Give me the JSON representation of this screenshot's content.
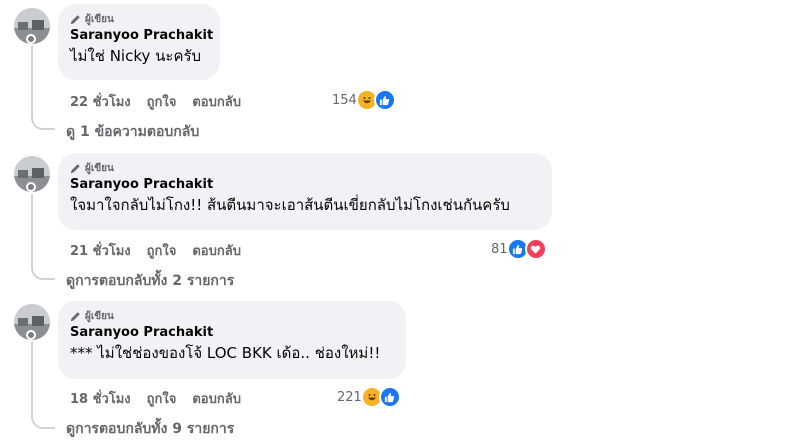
{
  "comments": [
    {
      "badge": "ผู้เขียน",
      "author": "Saranyoo Prachakit",
      "text": "ไม่ใช่ Nicky นะครับ",
      "time": "22 ชั่วโมง",
      "like_label": "ถูกใจ",
      "reply_label": "ตอบกลับ",
      "reaction_count": "154",
      "reactions": [
        "haha",
        "like"
      ],
      "replies_link": "ดู 1 ข้อความตอบกลับ"
    },
    {
      "badge": "ผู้เขียน",
      "author": "Saranyoo Prachakit",
      "text": "ใจมาใจกลับไม่โกง!! ส้นตีนมาจะเอาส้นตีนเขี่ยกลับไม่โกงเช่นกันครับ",
      "time": "21 ชั่วโมง",
      "like_label": "ถูกใจ",
      "reply_label": "ตอบกลับ",
      "reaction_count": "81",
      "reactions": [
        "like",
        "love"
      ],
      "replies_link": "ดูการตอบกลับทั้ง 2 รายการ"
    },
    {
      "badge": "ผู้เขียน",
      "author": "Saranyoo Prachakit",
      "text": "*** ไม่ใช่ช่องของโจ้ LOC BKK เด้อ.. ช่องใหม่!!",
      "time": "18 ชั่วโมง",
      "like_label": "ถูกใจ",
      "reply_label": "ตอบกลับ",
      "reaction_count": "221",
      "reactions": [
        "haha",
        "like"
      ],
      "replies_link": "ดูการตอบกลับทั้ง 9 รายการ"
    }
  ],
  "colors": {
    "bubble": "#f0f2f5",
    "muted": "#65676b",
    "like": "#1877f2",
    "love": "#f33e58",
    "haha": "#f7b125"
  }
}
